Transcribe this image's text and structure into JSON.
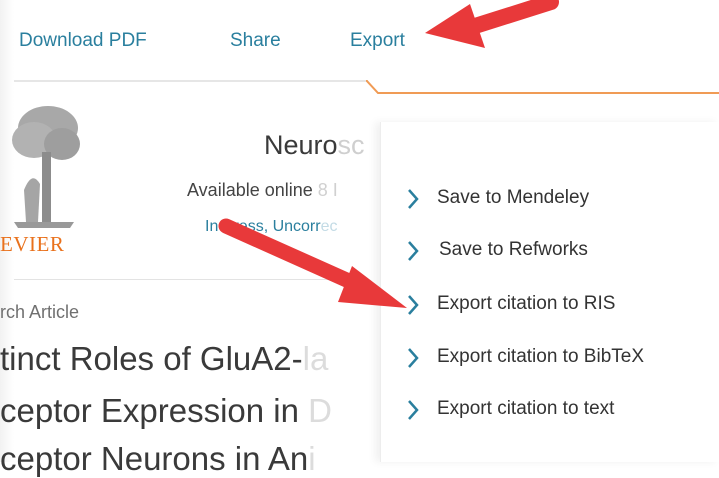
{
  "toolbar": {
    "download_pdf": "Download PDF",
    "share": "Share",
    "export": "Export"
  },
  "article": {
    "publisher": "EVIER",
    "journal": "Neuro",
    "journal_faded": "sc",
    "available_online": "Available online",
    "available_faded": "8 I",
    "status": "In Press, Uncorr",
    "status_faded": "ec",
    "article_type": "rch Article",
    "title_lines": [
      {
        "text": "tinct Roles of GluA2-",
        "faded": "la"
      },
      {
        "text": "ceptor Expression in ",
        "faded": "D"
      },
      {
        "text": "ceptor Neurons in An",
        "faded": "i"
      }
    ]
  },
  "export_menu": {
    "items": [
      {
        "label": "Save to Mendeley"
      },
      {
        "label": "Save to Refworks"
      },
      {
        "label": "Export citation to RIS"
      },
      {
        "label": "Export citation to BibTeX"
      },
      {
        "label": "Export citation to text"
      }
    ]
  },
  "icons": {
    "chevron": "chevron-right-icon",
    "annotation_arrow": "red-arrow"
  },
  "colors": {
    "link": "#2a7f9e",
    "publisher_orange": "#e9711c",
    "arrow_red": "#e8393a",
    "panel_top_border": "#f09b55"
  }
}
